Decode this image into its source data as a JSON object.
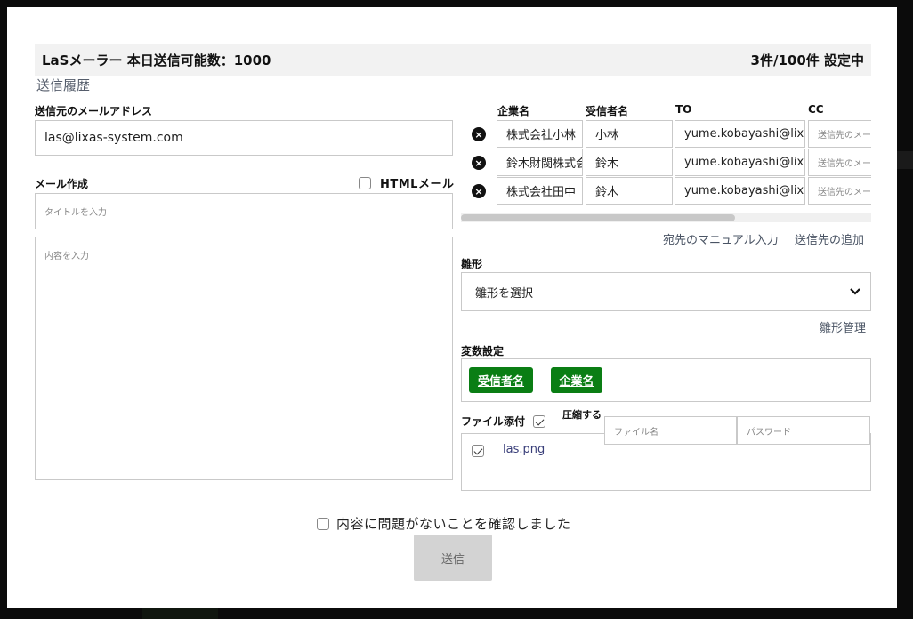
{
  "header": {
    "title": "LaSメーラー 本日送信可能数：1000",
    "status": "3件/100件 設定中"
  },
  "history_link": "送信履歴",
  "sender": {
    "label": "送信元のメールアドレス",
    "value": "las@lixas-system.com"
  },
  "compose": {
    "label": "メール作成",
    "html_mail_label": "HTMLメール",
    "html_mail_checked": false,
    "title_placeholder": "タイトルを入力",
    "body_placeholder": "内容を入力"
  },
  "recipients": {
    "columns": [
      "企業名",
      "受信者名",
      "TO",
      "CC"
    ],
    "rows": [
      {
        "company": "株式会社小林",
        "name": "小林",
        "to": "yume.kobayashi@lixas",
        "cc": "送信先のメールアドレス"
      },
      {
        "company": "鈴木財閥株式会社",
        "name": "鈴木",
        "to": "yume.kobayashi@lixas",
        "cc": "送信先のメールアドレス"
      },
      {
        "company": "株式会社田中",
        "name": "鈴木",
        "to": "yume.kobayashi@lixas",
        "cc": "送信先のメールアドレス"
      }
    ],
    "manual_input_link": "宛先のマニュアル入力",
    "add_recipient_link": "送信先の追加"
  },
  "template": {
    "label": "雛形",
    "select_value": "雛形を選択",
    "manage_link": "雛形管理"
  },
  "variables": {
    "label": "変数設定",
    "items": [
      "受信者名",
      "企業名"
    ]
  },
  "attachment": {
    "label": "ファイル添付",
    "compress_label": "圧縮する",
    "compress_checked": true,
    "filename_placeholder": "ファイル名",
    "password_placeholder": "パスワード",
    "files": [
      {
        "name": "las.png",
        "checked": true
      }
    ]
  },
  "confirm": {
    "label": "内容に問題がないことを確認しました",
    "checked": false
  },
  "send_button": "送信",
  "colors": {
    "variable_button": "#0a7e14",
    "header_bg": "#f2f2f2",
    "send_button_bg": "#d3d3d3"
  }
}
